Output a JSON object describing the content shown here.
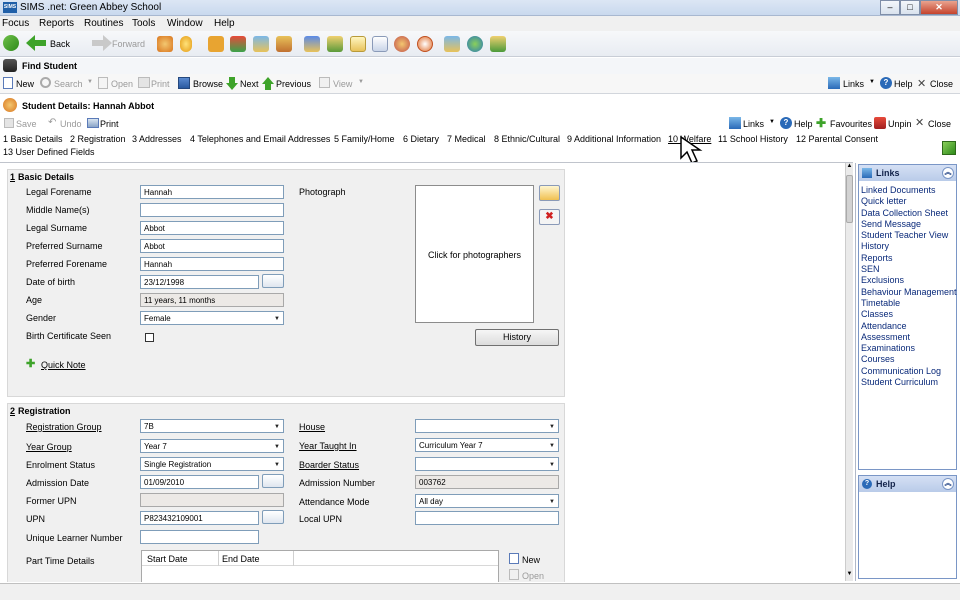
{
  "window": {
    "title": "SIMS .net: Green Abbey School",
    "app_icon": "SIMS"
  },
  "menu": [
    "Focus",
    "Reports",
    "Routines",
    "Tools",
    "Window",
    "Help"
  ],
  "main_toolbar": {
    "back": "Back",
    "forward": "Forward"
  },
  "find": {
    "title": "Find Student",
    "toolbar": {
      "new": "New",
      "search": "Search",
      "open": "Open",
      "print": "Print",
      "browse": "Browse",
      "next": "Next",
      "previous": "Previous",
      "view": "View",
      "links": "Links",
      "help": "Help",
      "close": "Close"
    }
  },
  "details": {
    "title": "Student Details: Hannah Abbot",
    "toolbar": {
      "save": "Save",
      "undo": "Undo",
      "print": "Print",
      "links": "Links",
      "help": "Help",
      "favourites": "Favourites",
      "unpin": "Unpin",
      "close": "Close"
    },
    "tabs": [
      "1 Basic Details",
      "2 Registration",
      "3 Addresses",
      "4 Telephones and Email Addresses",
      "5 Family/Home",
      "6 Dietary",
      "7 Medical",
      "8 Ethnic/Cultural",
      "9 Additional Information",
      "10 Welfare",
      "11 School History",
      "12 Parental Consent",
      "13 User Defined Fields"
    ]
  },
  "basic": {
    "section_num": "1",
    "section_title": "Basic Details",
    "labels": {
      "legal_forename": "Legal Forename",
      "middle_names": "Middle Name(s)",
      "legal_surname": "Legal Surname",
      "preferred_surname": "Preferred Surname",
      "preferred_forename": "Preferred Forename",
      "dob": "Date of birth",
      "age": "Age",
      "gender": "Gender",
      "birth_cert": "Birth Certificate Seen",
      "photograph": "Photograph"
    },
    "values": {
      "legal_forename": "Hannah",
      "middle_names": "",
      "legal_surname": "Abbot",
      "preferred_surname": "Abbot",
      "preferred_forename": "Hannah",
      "dob": "23/12/1998",
      "age": "11 years, 11 months",
      "gender": "Female"
    },
    "photo_text": "Click for photographers",
    "history_button": "History",
    "quick_note": "Quick Note"
  },
  "registration": {
    "section_num": "2",
    "section_title": "Registration",
    "labels": {
      "reg_group": "Registration Group",
      "year_group": "Year Group",
      "enrolment_status": "Enrolment Status",
      "admission_date": "Admission Date",
      "former_upn": "Former UPN",
      "upn": "UPN",
      "uln": "Unique Learner Number",
      "part_time": "Part Time Details",
      "house": "House",
      "year_taught_in": "Year Taught In",
      "boarder_status": "Boarder Status",
      "admission_number": "Admission Number",
      "attendance_mode": "Attendance Mode",
      "local_upn": "Local UPN"
    },
    "values": {
      "reg_group": "7B",
      "year_group": "Year  7",
      "enrolment_status": "Single Registration",
      "admission_date": "01/09/2010",
      "former_upn": "",
      "upn": "P823432109001",
      "uln": "",
      "house": "",
      "year_taught_in": "Curriculum Year  7",
      "boarder_status": "",
      "admission_number": "003762",
      "attendance_mode": "All day",
      "local_upn": ""
    },
    "part_time_columns": [
      "Start Date",
      "End Date"
    ],
    "part_time_new": "New",
    "part_time_open": "Open"
  },
  "sidebar": {
    "links_title": "Links",
    "links": [
      "Linked Documents",
      "Quick letter",
      "Data Collection Sheet",
      "Send Message",
      "Student Teacher View",
      "History",
      "Reports",
      "SEN",
      "Exclusions",
      "Behaviour Management",
      "Timetable",
      "Classes",
      "Attendance",
      "Assessment",
      "Examinations",
      "Courses",
      "Communication Log",
      "Student Curriculum"
    ],
    "help_title": "Help"
  }
}
